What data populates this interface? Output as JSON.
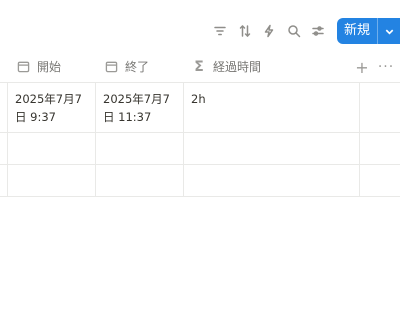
{
  "toolbar": {
    "icons": [
      "filter-icon",
      "sort-icon",
      "automation-icon",
      "search-icon",
      "settings-icon"
    ],
    "new_label": "新規"
  },
  "table": {
    "columns": [
      {
        "label": "開始",
        "icon": "calendar-icon"
      },
      {
        "label": "終了",
        "icon": "calendar-icon"
      },
      {
        "label": "経過時間",
        "icon": "sigma-icon"
      }
    ],
    "add_column": "+",
    "more": "···",
    "rows": [
      {
        "start": "2025年7月7日 9:37",
        "end": "2025年7月7日 11:37",
        "elapsed": "2h"
      },
      {
        "start": "",
        "end": "",
        "elapsed": ""
      },
      {
        "start": "",
        "end": "",
        "elapsed": ""
      }
    ]
  }
}
